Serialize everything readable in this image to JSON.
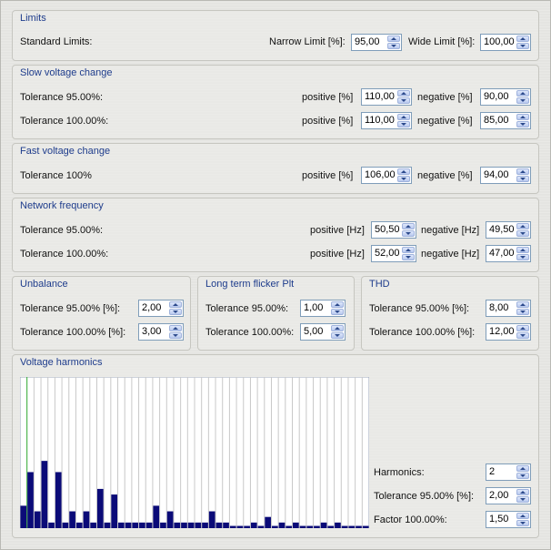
{
  "limits": {
    "title": "Limits",
    "standard_label": "Standard Limits:",
    "narrow_label": "Narrow Limit [%]:",
    "narrow_value": "95,00",
    "wide_label": "Wide Limit [%]:",
    "wide_value": "100,00"
  },
  "slow": {
    "title": "Slow voltage change",
    "rows": [
      {
        "label": "Tolerance 95.00%:",
        "pos_label": "positive [%]",
        "pos_value": "110,00",
        "neg_label": "negative [%]",
        "neg_value": "90,00"
      },
      {
        "label": "Tolerance 100.00%:",
        "pos_label": "positive [%]",
        "pos_value": "110,00",
        "neg_label": "negative [%]",
        "neg_value": "85,00"
      }
    ]
  },
  "fast": {
    "title": "Fast voltage change",
    "label": "Tolerance 100%",
    "pos_label": "positive [%]",
    "pos_value": "106,00",
    "neg_label": "negative [%]",
    "neg_value": "94,00"
  },
  "freq": {
    "title": "Network frequency",
    "rows": [
      {
        "label": "Tolerance 95.00%:",
        "pos_label": "positive [Hz]",
        "pos_value": "50,50",
        "neg_label": "negative [Hz]",
        "neg_value": "49,50"
      },
      {
        "label": "Tolerance 100.00%:",
        "pos_label": "positive [Hz]",
        "pos_value": "52,00",
        "neg_label": "negative [Hz]",
        "neg_value": "47,00"
      }
    ]
  },
  "unbalance": {
    "title": "Unbalance",
    "rows": [
      {
        "label": "Tolerance  95.00% [%]:",
        "value": "2,00"
      },
      {
        "label": "Tolerance  100.00% [%]:",
        "value": "3,00"
      }
    ]
  },
  "flicker": {
    "title": "Long term flicker Plt",
    "rows": [
      {
        "label": "Tolerance 95.00%:",
        "value": "1,00"
      },
      {
        "label": "Tolerance 100.00%:",
        "value": "5,00"
      }
    ]
  },
  "thd": {
    "title": "THD",
    "rows": [
      {
        "label": "Tolerance  95.00% [%]:",
        "value": "8,00"
      },
      {
        "label": "Tolerance  100.00% [%]:",
        "value": "12,00"
      }
    ]
  },
  "harmonics": {
    "title": "Voltage harmonics",
    "harmonics_label": "Harmonics:",
    "harmonics_value": "2",
    "tol_label": "Tolerance  95.00% [%]:",
    "tol_value": "2,00",
    "factor_label": "Factor 100.00%:",
    "factor_value": "1,50"
  },
  "chart_data": {
    "type": "bar",
    "title": "",
    "ylim": [
      0,
      13
    ],
    "grid": true,
    "colors": {
      "bar": "#0b0b78",
      "bg": "#ffffff",
      "grid": "#c8c8c8",
      "marker": "#2ea82e",
      "limit": "#cc2222"
    },
    "values": [
      2.0,
      5.0,
      1.5,
      6.0,
      0.5,
      5.0,
      0.5,
      1.5,
      0.5,
      1.5,
      0.5,
      3.5,
      0.5,
      3.0,
      0.5,
      0.5,
      0.5,
      0.5,
      0.5,
      2.0,
      0.5,
      1.5,
      0.5,
      0.5,
      0.5,
      0.5,
      0.5,
      1.5,
      0.5,
      0.5,
      0.2,
      0.2,
      0.2,
      0.5,
      0.2,
      1.0,
      0.2,
      0.5,
      0.2,
      0.5,
      0.2,
      0.2,
      0.2,
      0.5,
      0.2,
      0.5,
      0.2,
      0.2,
      0.2,
      0.2
    ]
  }
}
